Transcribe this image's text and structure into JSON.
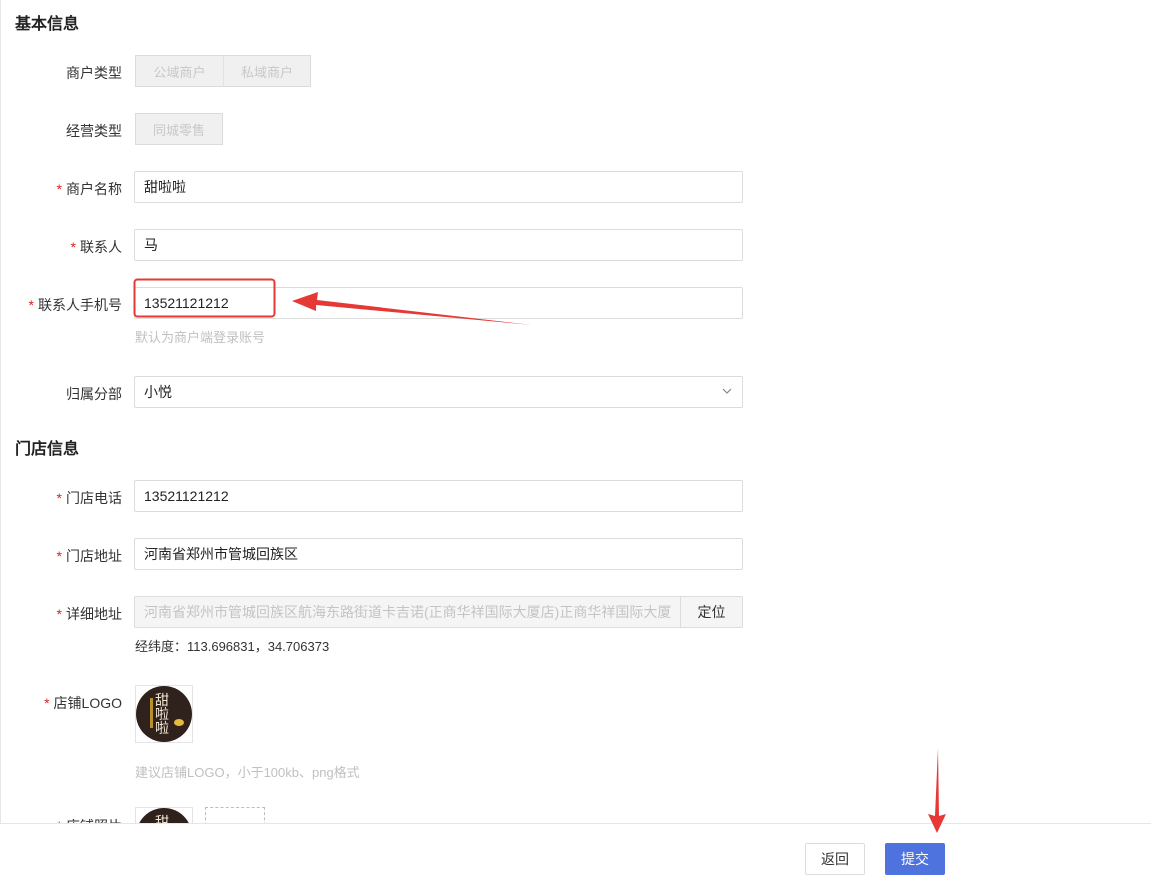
{
  "basic": {
    "title": "基本信息",
    "merchant_type": {
      "label": "商户类型",
      "options": [
        "公域商户",
        "私域商户"
      ]
    },
    "business_type": {
      "label": "经营类型",
      "options": [
        "同城零售"
      ]
    },
    "merchant_name": {
      "label": "商户名称",
      "value": "甜啦啦"
    },
    "contact": {
      "label": "联系人",
      "value": "马"
    },
    "contact_phone": {
      "label": "联系人手机号",
      "value": "13521121212",
      "hint": "默认为商户端登录账号"
    },
    "branch": {
      "label": "归属分部",
      "value": "小悦"
    }
  },
  "store": {
    "title": "门店信息",
    "phone": {
      "label": "门店电话",
      "value": "13521121212"
    },
    "address": {
      "label": "门店地址",
      "value": "河南省郑州市管城回族区"
    },
    "detail_address": {
      "label": "详细地址",
      "value": "河南省郑州市管城回族区航海东路街道卡吉诺(正商华祥国际大厦店)正商华祥国际大厦",
      "locate_label": "定位"
    },
    "coords": "经纬度：113.696831，34.706373",
    "logo": {
      "label": "店铺LOGO",
      "hint": "建议店铺LOGO，小于100kb、png格式",
      "glyphs": [
        "甜",
        "啦",
        "啦"
      ]
    },
    "photos": {
      "label": "店铺照片"
    }
  },
  "required_mark": "*",
  "footer": {
    "back_label": "返回",
    "submit_label": "提交"
  },
  "colors": {
    "primary": "#4e73df",
    "required": "#e02020",
    "annotation": "#e53935"
  }
}
